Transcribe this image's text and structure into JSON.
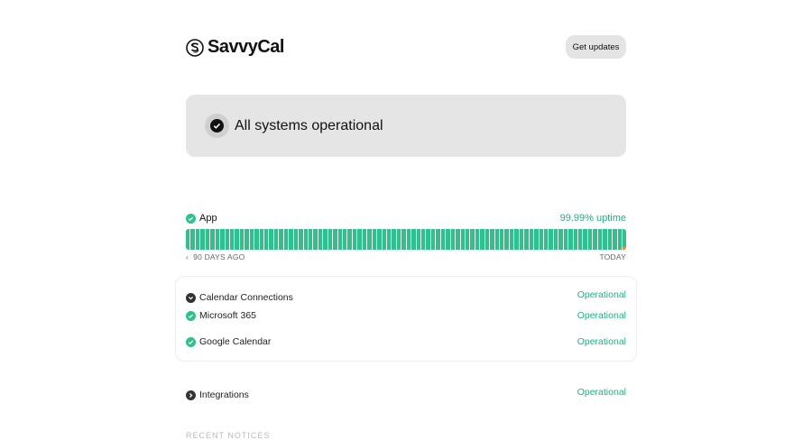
{
  "header": {
    "brand": "SavvyCal",
    "get_updates_label": "Get updates"
  },
  "banner": {
    "title": "All systems operational"
  },
  "app": {
    "name": "App",
    "uptime": "99.99% uptime",
    "bar_days": 90,
    "incident_days": [
      89
    ],
    "range_start": "90 DAYS AGO",
    "range_end": "TODAY"
  },
  "components": [
    {
      "name": "Calendar Connections",
      "status": "Operational",
      "type": "group-expanded"
    },
    {
      "name": "Microsoft 365",
      "status": "Operational",
      "type": "child"
    },
    {
      "name": "Google Calendar",
      "status": "Operational",
      "type": "child"
    },
    {
      "name": "Integrations",
      "status": "Operational",
      "type": "group-collapsed"
    }
  ],
  "footer": {
    "section_title": "RECENT NOTICES"
  },
  "colors": {
    "green": "#2ec28a",
    "incident": "#f08a3c"
  }
}
